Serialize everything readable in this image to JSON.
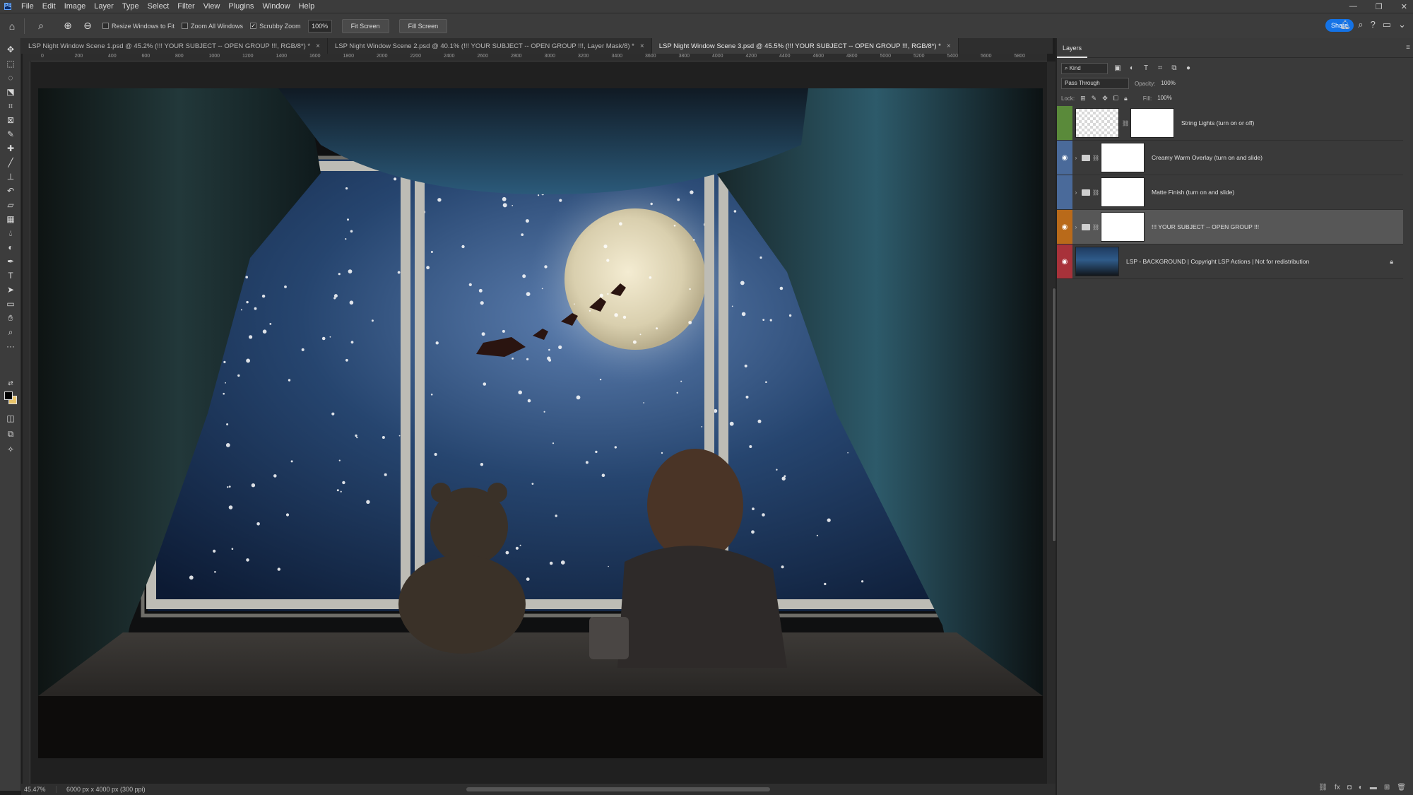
{
  "menubar": {
    "items": [
      "File",
      "Edit",
      "Image",
      "Layer",
      "Type",
      "Select",
      "Filter",
      "View",
      "Plugins",
      "Window",
      "Help"
    ]
  },
  "options": {
    "resize_windows": "Resize Windows to Fit",
    "zoom_all_windows": "Zoom All Windows",
    "scrubby_zoom": "Scrubby Zoom",
    "zoom_value": "100%",
    "fit_screen": "Fit Screen",
    "fill_screen": "Fill Screen",
    "share": "Share"
  },
  "tabs": [
    {
      "label": "LSP Night Window Scene 1.psd @ 45.2% (!!! YOUR SUBJECT -- OPEN GROUP !!!, RGB/8*) *"
    },
    {
      "label": "LSP Night Window Scene 2.psd @ 40.1% (!!! YOUR SUBJECT -- OPEN GROUP !!!, Layer Mask/8) *"
    },
    {
      "label": "LSP Night Window Scene 3.psd @ 45.5% (!!! YOUR SUBJECT -- OPEN GROUP !!!, RGB/8*) *"
    }
  ],
  "ruler": {
    "h_ticks": [
      "0",
      "200",
      "400",
      "600",
      "800",
      "1000",
      "1200",
      "1400",
      "1600",
      "1800",
      "2000",
      "2200",
      "2400",
      "2600",
      "2800",
      "3000",
      "3200",
      "3400",
      "3600",
      "3800",
      "4000",
      "4200",
      "4400",
      "4600",
      "4800",
      "5000",
      "5200",
      "5400",
      "5600",
      "5800"
    ]
  },
  "status": {
    "zoom": "45.47%",
    "doc_info": "6000 px x 4000 px (300 ppi)"
  },
  "layers_panel": {
    "title": "Layers",
    "kind": "Kind",
    "blend_mode": "Pass Through",
    "opacity_label": "Opacity:",
    "opacity_value": "100%",
    "lock_label": "Lock:",
    "fill_label": "Fill:",
    "fill_value": "100%",
    "layers": [
      {
        "name": "String Lights (turn on or off)",
        "color": "#5a8a3a"
      },
      {
        "name": "Creamy Warm Overlay (turn on and slide)",
        "color": "#4a6a9a"
      },
      {
        "name": "Matte Finish (turn on and slide)",
        "color": "#4a6a9a"
      },
      {
        "name": "!!! YOUR SUBJECT -- OPEN GROUP !!!",
        "color": "#b96a1a"
      },
      {
        "name": "LSP - BACKGROUND | Copyright LSP Actions | Not for redistribution",
        "color": "#a8323a"
      }
    ]
  }
}
